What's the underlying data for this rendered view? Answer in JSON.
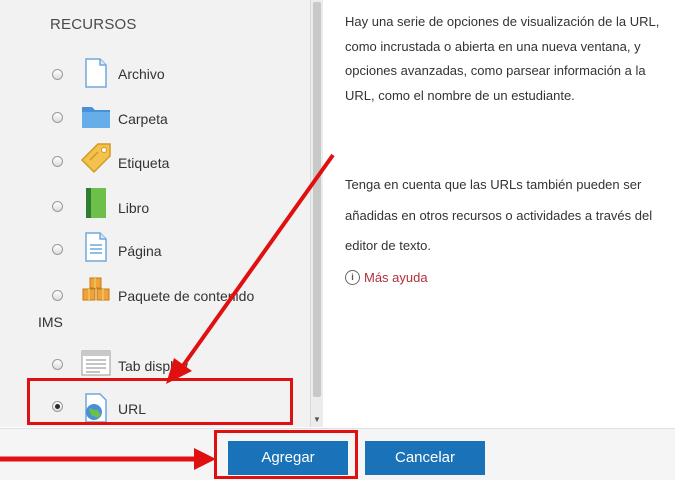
{
  "resources": {
    "title": "RECURSOS",
    "items": [
      {
        "label": "Archivo",
        "icon": "file-icon",
        "selected": false
      },
      {
        "label": "Carpeta",
        "icon": "folder-icon",
        "selected": false
      },
      {
        "label": "Etiqueta",
        "icon": "tag-icon",
        "selected": false
      },
      {
        "label": "Libro",
        "icon": "book-icon",
        "selected": false
      },
      {
        "label": "Página",
        "icon": "page-icon",
        "selected": false
      },
      {
        "label": "Paquete de contenido",
        "label_line2": "IMS",
        "icon": "package-icon",
        "selected": false
      },
      {
        "label": "Tab display",
        "icon": "tab-display-icon",
        "selected": false
      },
      {
        "label": "URL",
        "icon": "globe-icon",
        "selected": true
      }
    ]
  },
  "help": {
    "paragraph1": "Hay una serie de opciones de visualización de la URL, como incrustada o abierta en una nueva ventana, y opciones avanzadas, como parsear información a la URL, como el nombre de un estudiante.",
    "paragraph2": "Tenga en cuenta que las URLs también pueden ser añadidas en otros recursos o actividades a través del editor de texto.",
    "more_help": "Más ayuda"
  },
  "buttons": {
    "add": "Agregar",
    "cancel": "Cancelar"
  },
  "colors": {
    "button_blue": "#1a73b8",
    "annotation_red": "#e01010",
    "link_red": "#b0303a"
  }
}
